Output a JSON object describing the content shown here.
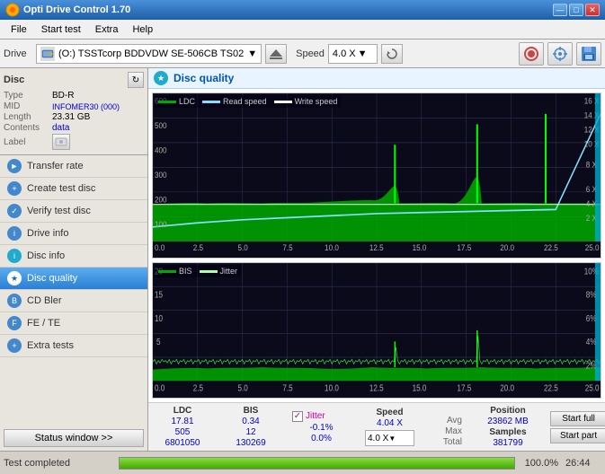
{
  "window": {
    "title": "Opti Drive Control 1.70",
    "controls": [
      "—",
      "□",
      "✕"
    ]
  },
  "menu": {
    "items": [
      "File",
      "Start test",
      "Extra",
      "Help"
    ]
  },
  "toolbar": {
    "drive_label": "Drive",
    "drive_name": "(O:)  TSSTcorp BDDVDW SE-506CB TS02",
    "speed_label": "Speed",
    "speed_value": "4.0 X"
  },
  "sidebar": {
    "disc_title": "Disc",
    "disc_type_label": "Type",
    "disc_type_value": "BD-R",
    "disc_mid_label": "MID",
    "disc_mid_value": "INFOMER30 (000)",
    "disc_length_label": "Length",
    "disc_length_value": "23.31 GB",
    "disc_contents_label": "Contents",
    "disc_contents_value": "data",
    "disc_label_label": "Label",
    "nav_items": [
      {
        "id": "transfer-rate",
        "label": "Transfer rate",
        "active": false
      },
      {
        "id": "create-test-disc",
        "label": "Create test disc",
        "active": false
      },
      {
        "id": "verify-test-disc",
        "label": "Verify test disc",
        "active": false
      },
      {
        "id": "drive-info",
        "label": "Drive info",
        "active": false
      },
      {
        "id": "disc-info",
        "label": "Disc info",
        "active": false
      },
      {
        "id": "disc-quality",
        "label": "Disc quality",
        "active": true
      },
      {
        "id": "cd-bler",
        "label": "CD Bler",
        "active": false
      },
      {
        "id": "fe-te",
        "label": "FE / TE",
        "active": false
      },
      {
        "id": "extra-tests",
        "label": "Extra tests",
        "active": false
      }
    ],
    "status_btn": "Status window >>"
  },
  "chart": {
    "title": "Disc quality",
    "legend_top": [
      {
        "label": "LDC",
        "color": "#00aa00"
      },
      {
        "label": "Read speed",
        "color": "#88ddff"
      },
      {
        "label": "Write speed",
        "color": "#ffffff"
      }
    ],
    "legend_bottom": [
      {
        "label": "BIS",
        "color": "#00aa00"
      },
      {
        "label": "Jitter",
        "color": "#ffffff"
      }
    ],
    "x_max": "25.0 GB",
    "y_left_max_top": "600",
    "y_right_max_top": "16 X",
    "y_left_max_bottom": "20",
    "y_right_max_bottom": "10%"
  },
  "stats": {
    "ldc_label": "LDC",
    "bis_label": "BIS",
    "jitter_label": "Jitter",
    "speed_label": "Speed",
    "position_label": "Position",
    "samples_label": "Samples",
    "avg_label": "Avg",
    "max_label": "Max",
    "total_label": "Total",
    "ldc_avg": "17.81",
    "ldc_max": "505",
    "ldc_total": "6801050",
    "bis_avg": "0.34",
    "bis_max": "12",
    "bis_total": "130269",
    "jitter_avg": "-0.1%",
    "jitter_max": "0.0%",
    "speed_value": "4.04 X",
    "speed_dropdown": "4.0 X",
    "position_value": "23862 MB",
    "samples_value": "381799",
    "start_full_btn": "Start full",
    "start_part_btn": "Start part"
  },
  "status_bar": {
    "text": "Test completed",
    "progress": 100,
    "progress_text": "100.0%",
    "time": "26:44"
  }
}
